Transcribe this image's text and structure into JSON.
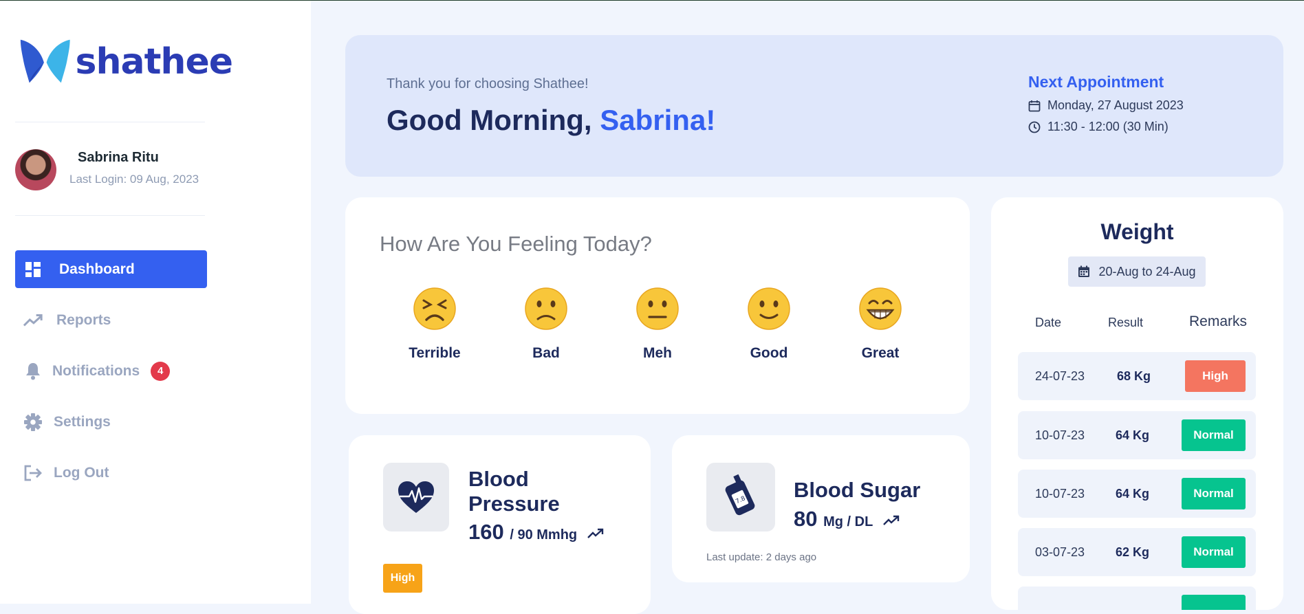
{
  "brand": {
    "name": "shathee"
  },
  "user": {
    "name": "Sabrina Ritu",
    "last_login": "Last Login: 09 Aug, 2023"
  },
  "nav": [
    {
      "label": "Dashboard",
      "icon": "dashboard-icon",
      "active": true
    },
    {
      "label": "Reports",
      "icon": "trending-up-icon"
    },
    {
      "label": "Notifications",
      "icon": "bell-icon",
      "badge": "4"
    },
    {
      "label": "Settings",
      "icon": "gear-icon"
    },
    {
      "label": "Log Out",
      "icon": "logout-icon"
    }
  ],
  "welcome": {
    "thanks": "Thank you for choosing Shathee!",
    "greeting": "Good Morning,",
    "name": "Sabrina!"
  },
  "appointment": {
    "title": "Next Appointment",
    "date": "Monday, 27 August 2023",
    "time": "11:30 - 12:00 (30 Min)"
  },
  "feeling": {
    "question": "How Are You Feeling Today?",
    "moods": [
      "Terrible",
      "Bad",
      "Meh",
      "Good",
      "Great"
    ]
  },
  "blood_pressure": {
    "title_line1": "Blood",
    "title_line2": "Pressure",
    "value": "160",
    "unit": "/ 90 Mmhg",
    "status": "High",
    "icon": "heart-pulse-icon"
  },
  "blood_sugar": {
    "title": "Blood Sugar",
    "value": "80",
    "unit": "Mg / DL",
    "last_update": "Last update: 2 days ago",
    "icon": "glucose-meter-icon",
    "meter_reading": "7.8"
  },
  "weight": {
    "title": "Weight",
    "range": "20-Aug to 24-Aug",
    "headers": {
      "date": "Date",
      "result": "Result",
      "remarks": "Remarks"
    },
    "rows": [
      {
        "date": "24-07-23",
        "result": "68 Kg",
        "remark": "High"
      },
      {
        "date": "10-07-23",
        "result": "64 Kg",
        "remark": "Normal"
      },
      {
        "date": "10-07-23",
        "result": "64 Kg",
        "remark": "Normal"
      },
      {
        "date": "03-07-23",
        "result": "62 Kg",
        "remark": "Normal"
      }
    ]
  },
  "colors": {
    "primary": "#3460f0",
    "high": "#f47560",
    "normal": "#06c48f",
    "warning": "#f7a318",
    "badge": "#e33a4b"
  }
}
